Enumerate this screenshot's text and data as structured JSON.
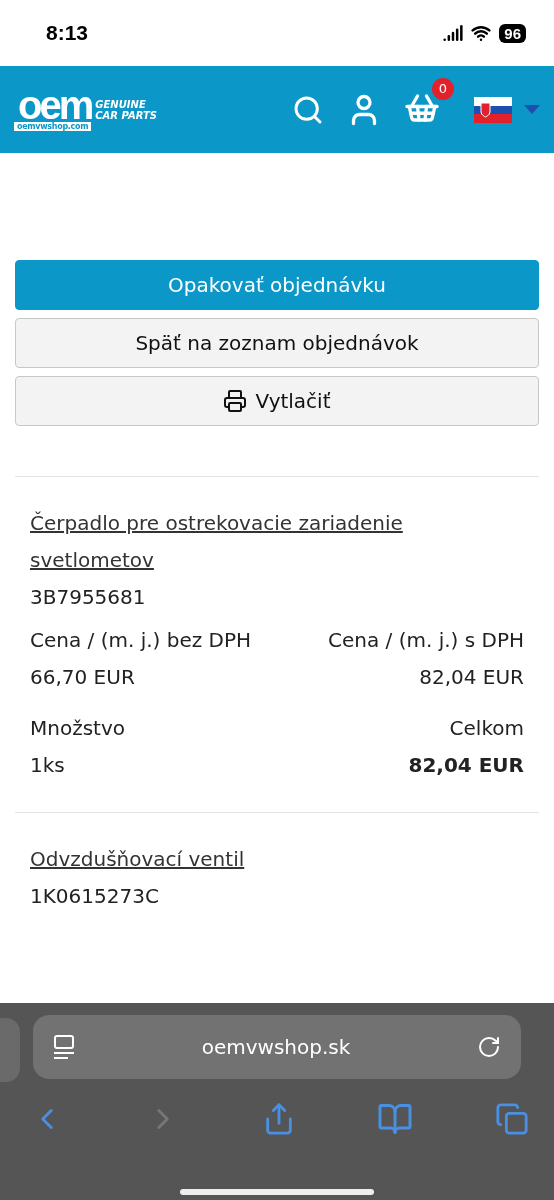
{
  "status_bar": {
    "time": "8:13",
    "battery": "96"
  },
  "header": {
    "logo": {
      "mark": "oem",
      "line_1": "GENUINE",
      "line_2": "CAR PARTS",
      "domain": "oemvwshop.com"
    },
    "cart_count": "0"
  },
  "actions": [
    {
      "label": "Opakovať objednávku",
      "kind": "primary"
    },
    {
      "label": "Späť na zoznam objednávok",
      "kind": "secondary"
    },
    {
      "label": "Vytlačiť",
      "kind": "print"
    }
  ],
  "items": [
    {
      "name": "Čerpadlo pre ostrekovacie zariadenie svetlometov",
      "code": "3B7955681",
      "price_net_label": "Cena / (m. j.) bez DPH",
      "price_gross_label": "Cena / (m. j.) s DPH",
      "price_net": "66,70 EUR",
      "price_gross": "82,04 EUR",
      "quantity_label": "Množstvo",
      "total_label": "Celkom",
      "quantity": "1ks",
      "total": "82,04 EUR"
    },
    {
      "name": "Odvzdušňovací ventil",
      "code": "1K0615273C"
    }
  ],
  "browser": {
    "address": "oemvwshop.sk"
  }
}
